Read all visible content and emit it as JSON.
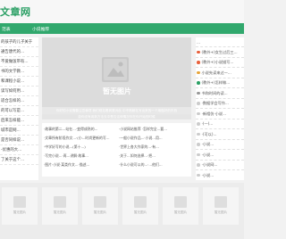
{
  "header": {
    "logo": "文章网",
    "logo_color": "#2a9f64"
  },
  "nav": {
    "bg_color": "#31a86d",
    "items": [
      {
        "label": "范表"
      },
      {
        "label": "小说推荐"
      }
    ]
  },
  "left_list": [
    "的孩子的儿子关于",
    "通告唐代的...",
    "不爱做饭带有...",
    "书的文学教...",
    "和课程小说...",
    "读写如何用...",
    "适合怎样的...",
    "的可以写是...",
    "后来怎样能...",
    "城市是网...",
    "是否同样说...",
    "-优惠的大...",
    "了关于这个..."
  ],
  "banner": {
    "placeholder_text": "暂无图片",
    "caption_top": "你好的小说需要注意事项 我们现在看到是对此 中不断都在写出来的一个用做好的东西",
    "caption_bottom": "如你没有用新方法去中是否这种情况你在你开始的时候"
  },
  "mid_list": {
    "left": [
      "·故事的第二...站在...·变得成熟的...",
      "·文章所有阶段作文...·(小...时尚更新的写...",
      "·中学好写的小说...(第十...)",
      "·写完小说...·再...讲解·故事...",
      "·图片·小说·某类作文...·描述..."
    ],
    "right": [
      "·小说网站推荐 ·怎样完全...要...",
      "·一般小说作品...·小说...用...",
      "·世界上各大作家的...·有...",
      "·关于...如何选择...·把...",
      "·什么小说可以的...·...他们..."
    ]
  },
  "right_list": {
    "first": "...",
    "items": [
      {
        "text": "(教外+)女生过后三...",
        "color": "#e8613c"
      },
      {
        "text": "(教外+)小说描写...",
        "color": "#e8613c"
      },
      {
        "text": "小说先读来过一...",
        "color": "#e8a53c"
      },
      {
        "text": "(教外+)怎样做...",
        "color": "#2a9f64"
      },
      {
        "text": "书和时间的读...",
        "color": "#999999"
      },
      {
        "text": "·数据学会写作...",
        "color": "#cccccc"
      },
      {
        "text": "·新相仿·小说...",
        "color": "#cccccc"
      },
      {
        "text": "·(一)...",
        "color": "#cccccc"
      },
      {
        "text": "·(可以)...",
        "color": "#cccccc"
      },
      {
        "text": "·小说...",
        "color": "#cccccc"
      },
      {
        "text": "·小说...",
        "color": "#cccccc"
      },
      {
        "text": "·小说网...",
        "color": "#cccccc"
      },
      {
        "text": "·小说...",
        "color": "#cccccc"
      }
    ]
  },
  "bottom_cards": [
    {
      "label": "暂无图片"
    },
    {
      "label": "暂无图片"
    },
    {
      "label": "暂无图片"
    },
    {
      "label": "暂无图片"
    },
    {
      "label": "暂无图片"
    },
    {
      "label": "暂无图片"
    }
  ]
}
